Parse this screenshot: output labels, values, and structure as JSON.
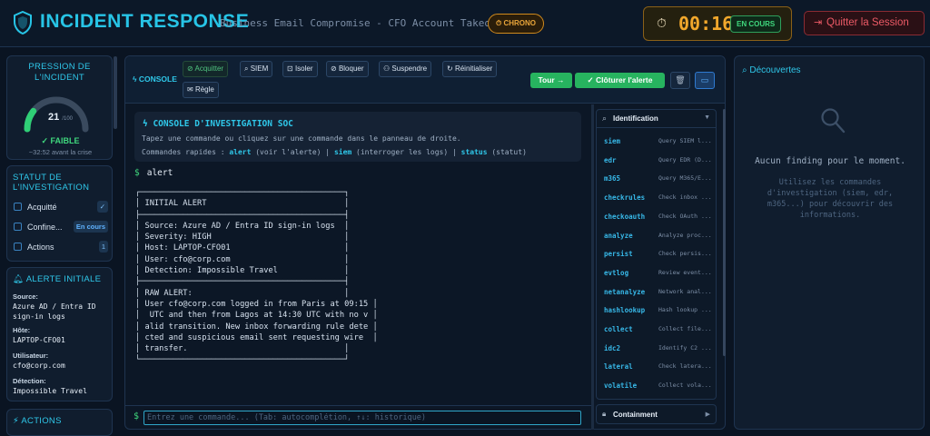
{
  "header": {
    "app_title": "INCIDENT RESPONSE",
    "scenario": "Business Email Compromise - CFO Account Takeover",
    "chrono_badge": "⏱ CHRONO",
    "timer": "00:16",
    "status": "EN COURS",
    "quit_label": "Quitter la Session"
  },
  "pressure": {
    "title": "PRESSION DE L'INCIDENT",
    "value": "21",
    "unit": "/100",
    "level": "FAIBLE",
    "crisis": "~32:52 avant la crise",
    "gauge_fraction": 0.21
  },
  "investigation": {
    "title": "STATUT DE L'INVESTIGATION",
    "items": [
      {
        "label": "Acquitté",
        "badge": "✓"
      },
      {
        "label": "Confine...",
        "badge": "En cours"
      },
      {
        "label": "Actions",
        "badge": "1"
      }
    ]
  },
  "alert": {
    "title": "ALERTE INITIALE",
    "source_label": "Source:",
    "source_value": "Azure AD / Entra ID sign-in logs",
    "host_label": "Hôte:",
    "host_value": "LAPTOP-CFO01",
    "user_label": "Utilisateur:",
    "user_value": "cfo@corp.com",
    "detection_label": "Détection:",
    "detection_value": "Impossible Travel"
  },
  "actions_panel": {
    "title": "ACTIONS"
  },
  "console": {
    "label": "CONSOLE",
    "toolbar": {
      "acquit": "Acquitter",
      "siem": "SIEM",
      "isolate": "Isoler",
      "block": "Bloquer",
      "suspend": "Suspendre",
      "reset": "Réinitialiser",
      "rule": "Règle",
      "tour": "Tour →",
      "close_alert": "Clôturer l'alerte"
    },
    "intro_title": "CONSOLE D'INVESTIGATION SOC",
    "intro_line1": "Tapez une commande ou cliquez sur une commande dans le panneau de droite.",
    "intro_quick_prefix": "Commandes rapides : ",
    "intro_quick_alert": "alert",
    "intro_quick_alert_desc": " (voir l'alerte) | ",
    "intro_quick_siem": "siem",
    "intro_quick_siem_desc": " (interroger les logs) | ",
    "intro_quick_status": "status",
    "intro_quick_status_desc": " (statut)",
    "prompt_symbol": "$",
    "last_command": "alert",
    "output": "┌───────────────────────────────────────────┐\n│ INITIAL ALERT                             │\n├───────────────────────────────────────────┤\n│ Source: Azure AD / Entra ID sign-in logs  │\n│ Severity: HIGH                            │\n│ Host: LAPTOP-CFO01                        │\n│ User: cfo@corp.com                        │\n│ Detection: Impossible Travel              │\n├───────────────────────────────────────────┤\n│ RAW ALERT:                                │\n│ User cfo@corp.com logged in from Paris at 09:15 │\n│  UTC and then from Lagos at 14:30 UTC with no v │\n│ alid transition. New inbox forwarding rule dete │\n│ cted and suspicious email sent requesting wire  │\n│ transfer.                                 │\n└───────────────────────────────────────────┘",
    "input_placeholder": "Entrez une commande... (Tab: autocomplétion, ↑↓: historique)"
  },
  "commands": {
    "section_title": "Identification",
    "items": [
      {
        "name": "siem",
        "desc": "Query SIEM l..."
      },
      {
        "name": "edr",
        "desc": "Query EDR (D..."
      },
      {
        "name": "m365",
        "desc": "Query M365/E..."
      },
      {
        "name": "checkrules",
        "desc": "Check inbox ..."
      },
      {
        "name": "checkoauth",
        "desc": "Check OAuth ..."
      },
      {
        "name": "analyze",
        "desc": "Analyze proc..."
      },
      {
        "name": "persist",
        "desc": "Check persis..."
      },
      {
        "name": "evtlog",
        "desc": "Review event..."
      },
      {
        "name": "netanalyze",
        "desc": "Network anal..."
      },
      {
        "name": "hashlookup",
        "desc": "Hash lookup ..."
      },
      {
        "name": "collect",
        "desc": "Collect file..."
      },
      {
        "name": "idc2",
        "desc": "Identify C2 ..."
      },
      {
        "name": "lateral",
        "desc": "Check latera..."
      },
      {
        "name": "volatile",
        "desc": "Collect vola..."
      }
    ],
    "containment_title": "Containment"
  },
  "discoveries": {
    "title": "Découvertes",
    "empty": "Aucun finding pour le moment.",
    "hint": "Utilisez les commandes d'investigation (siem, edr, m365...) pour découvrir des informations."
  },
  "colors": {
    "accent": "#2fc8ea",
    "success": "#27b35f",
    "warning": "#f2a82c",
    "danger": "#ec5a66",
    "background": "#0a1422"
  }
}
